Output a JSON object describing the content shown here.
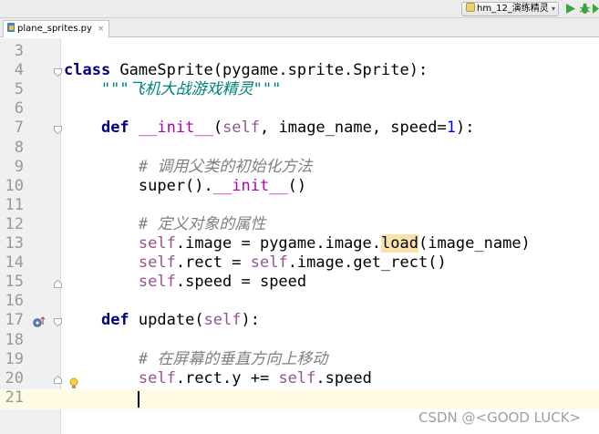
{
  "toolbar": {
    "run_config_label": "hm_12_演练精灵",
    "run_config_dropdown": "▾"
  },
  "tab": {
    "file_name": "plane_sprites.py",
    "close_glyph": "×"
  },
  "editor": {
    "lines": [
      {
        "number": "3"
      },
      {
        "number": "4",
        "tokens": [
          {
            "t": "class",
            "c": "kw"
          },
          {
            "t": " GameSprite(pygame.sprite.Sprite):"
          }
        ]
      },
      {
        "number": "5",
        "tokens": [
          {
            "t": "    \"\"\"飞机大战游戏精灵\"\"\"",
            "c": "doc"
          }
        ]
      },
      {
        "number": "6"
      },
      {
        "number": "7",
        "tokens": [
          {
            "t": "    "
          },
          {
            "t": "def",
            "c": "kw"
          },
          {
            "t": " "
          },
          {
            "t": "__init__",
            "c": "dunder"
          },
          {
            "t": "("
          },
          {
            "t": "self",
            "c": "sf"
          },
          {
            "t": ", image_name, speed="
          },
          {
            "t": "1",
            "c": "num"
          },
          {
            "t": "):"
          }
        ]
      },
      {
        "number": "8"
      },
      {
        "number": "9",
        "tokens": [
          {
            "t": "        # 调用父类的初始化方法",
            "c": "cm"
          }
        ]
      },
      {
        "number": "10",
        "tokens": [
          {
            "t": "        super()."
          },
          {
            "t": "__init__",
            "c": "dunder"
          },
          {
            "t": "()"
          }
        ]
      },
      {
        "number": "11"
      },
      {
        "number": "12",
        "tokens": [
          {
            "t": "        # 定义对象的属性",
            "c": "cm"
          }
        ]
      },
      {
        "number": "13",
        "tokens": [
          {
            "t": "        "
          },
          {
            "t": "self",
            "c": "sf"
          },
          {
            "t": ".image = pygame.image."
          },
          {
            "t": "load",
            "c": "hl"
          },
          {
            "t": "(image_name)"
          }
        ]
      },
      {
        "number": "14",
        "tokens": [
          {
            "t": "        "
          },
          {
            "t": "self",
            "c": "sf"
          },
          {
            "t": ".rect = "
          },
          {
            "t": "self",
            "c": "sf"
          },
          {
            "t": ".image.get_rect()"
          }
        ]
      },
      {
        "number": "15",
        "tokens": [
          {
            "t": "        "
          },
          {
            "t": "self",
            "c": "sf"
          },
          {
            "t": ".speed = speed"
          }
        ]
      },
      {
        "number": "16"
      },
      {
        "number": "17",
        "tokens": [
          {
            "t": "    "
          },
          {
            "t": "def",
            "c": "kw"
          },
          {
            "t": " update("
          },
          {
            "t": "self",
            "c": "sf"
          },
          {
            "t": "):"
          }
        ]
      },
      {
        "number": "18"
      },
      {
        "number": "19",
        "tokens": [
          {
            "t": "        # 在屏幕的垂直方向上移动",
            "c": "cm"
          }
        ]
      },
      {
        "number": "20",
        "tokens": [
          {
            "t": "        "
          },
          {
            "t": "self",
            "c": "sf"
          },
          {
            "t": ".rect.y += "
          },
          {
            "t": "self",
            "c": "sf"
          },
          {
            "t": ".speed"
          }
        ]
      },
      {
        "number": "21"
      }
    ]
  },
  "gutter_icons": [
    "fold-marker",
    "override-method-icon",
    "lightbulb-icon"
  ],
  "watermark": "CSDN @<GOOD LUCK>",
  "colors": {
    "keyword": "#000080",
    "self": "#94558d",
    "dunder": "#b200b2",
    "number": "#0000ff",
    "docstring": "#008080",
    "comment": "#808080",
    "caret_line": "#fffae3",
    "usage_highlight": "#f7e3a8"
  }
}
